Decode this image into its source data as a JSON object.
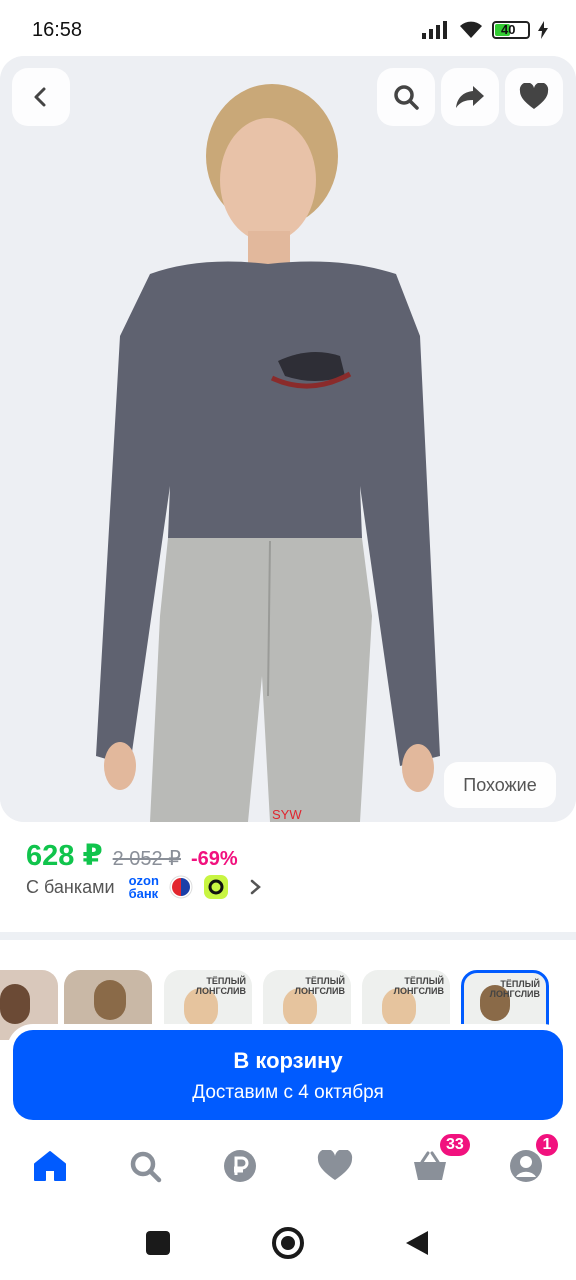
{
  "status_bar": {
    "time": "16:58",
    "battery": "40",
    "icons": [
      "signal-icon",
      "wifi-icon",
      "battery-icon",
      "charging-icon"
    ]
  },
  "product_image": {
    "brand_mark": "SYW",
    "similar_label": "Похожие",
    "buttons": [
      "back-icon",
      "search-icon",
      "share-icon",
      "heart-icon"
    ]
  },
  "price": {
    "current": "628 ₽",
    "old": "2 052 ₽",
    "discount": "-69%",
    "bank_label": "С банками",
    "ozon_line1": "ozon",
    "ozon_line2": "банк"
  },
  "thumbnails": {
    "promo_text_1": "ТЁПЛЫЙ",
    "promo_text_2": "ЛОНГСЛИВ"
  },
  "cart": {
    "title": "В корзину",
    "subtitle": "Доставим с 4 октября"
  },
  "bottom_nav": {
    "cart_badge": "33",
    "profile_badge": "1",
    "items": [
      "home-icon",
      "search-icon",
      "ruble-icon",
      "heart-icon",
      "basket-icon",
      "profile-icon"
    ]
  },
  "colors": {
    "accent": "#005bff",
    "price_green": "#10c44c",
    "discount_pink": "#f1117e"
  }
}
